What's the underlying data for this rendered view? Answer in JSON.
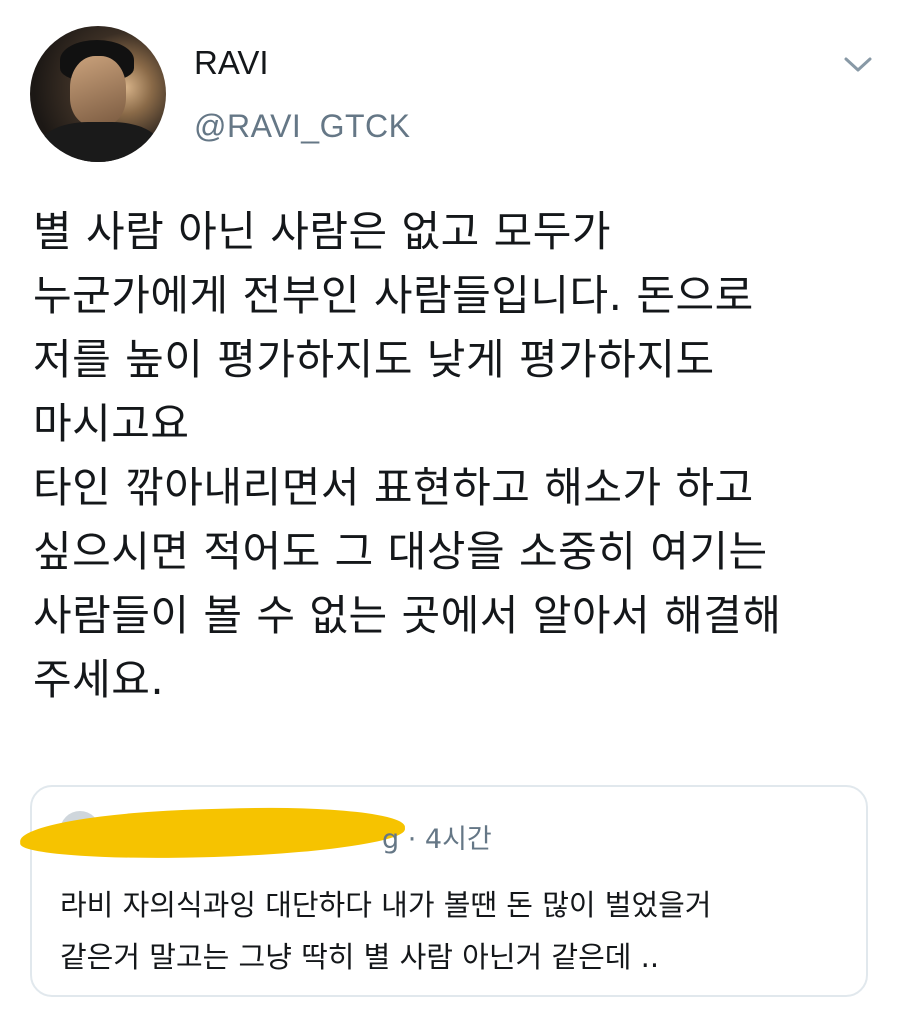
{
  "user": {
    "name": "RAVI",
    "handle": "@RAVI_GTCK"
  },
  "icons": {
    "more": "chevron-down-icon"
  },
  "tweet": {
    "text": "별 사람 아닌 사람은 없고 모두가\n누군가에게 전부인 사람들입니다. 돈으로\n저를 높이 평가하지도 낮게 평가하지도\n마시고요\n타인 깎아내리면서 표현하고 해소가 하고\n싶으시면 적어도 그 대상을 소중히 여기는\n사람들이 볼 수 없는 곳에서 알아서 해결해\n주세요."
  },
  "quoted": {
    "meta": "g · 4시간",
    "text": "라비 자의식과잉 대단하다 내가 볼땐 돈 많이 벌었을거\n같은거 말고는 그냥 딱히 별 사람 아닌거 같은데 .."
  },
  "colors": {
    "text": "#14171a",
    "secondary": "#657786",
    "border": "#e1e8ed",
    "redaction": "#f6c300"
  }
}
